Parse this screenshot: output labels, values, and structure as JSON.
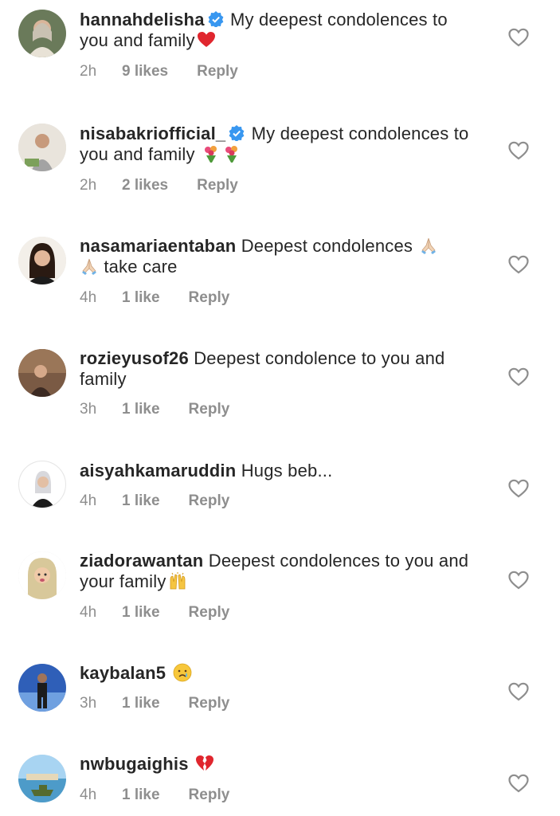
{
  "comments": [
    {
      "username": "hannahdelisha",
      "verified": true,
      "text": "My deepest condolences to you and family",
      "emoji": "red-heart",
      "time": "2h",
      "likes": "9 likes",
      "reply": "Reply"
    },
    {
      "username": "nisabakriofficial_",
      "verified": true,
      "text": "My deepest condolences to you and family",
      "emoji": "bouquet-bouquet",
      "time": "2h",
      "likes": "2 likes",
      "reply": "Reply"
    },
    {
      "username": "nasamariaentaban",
      "verified": false,
      "text": "Deepest condolences",
      "text_after_emoji": "take care",
      "emoji": "folded-hands",
      "time": "4h",
      "likes": "1 like",
      "reply": "Reply"
    },
    {
      "username": "rozieyusof26",
      "verified": false,
      "text": "Deepest condolence to you and family",
      "emoji": "",
      "time": "3h",
      "likes": "1 like",
      "reply": "Reply"
    },
    {
      "username": "aisyahkamaruddin",
      "verified": false,
      "text": "Hugs beb...",
      "emoji": "",
      "time": "4h",
      "likes": "1 like",
      "reply": "Reply"
    },
    {
      "username": "ziadorawantan",
      "verified": false,
      "text": "Deepest condolences to you and your family",
      "emoji": "raising-hands",
      "time": "4h",
      "likes": "1 like",
      "reply": "Reply"
    },
    {
      "username": "kaybalan5",
      "verified": false,
      "text": "",
      "emoji": "crying-face",
      "time": "3h",
      "likes": "1 like",
      "reply": "Reply"
    },
    {
      "username": "nwbugaighis",
      "verified": false,
      "text": "",
      "emoji": "broken-heart",
      "time": "4h",
      "likes": "1 like",
      "reply": "Reply"
    }
  ],
  "colors": {
    "text": "#262626",
    "meta": "#8e8e8e",
    "verified": "#3897f0",
    "heart_outline": "#8e8e8e"
  }
}
